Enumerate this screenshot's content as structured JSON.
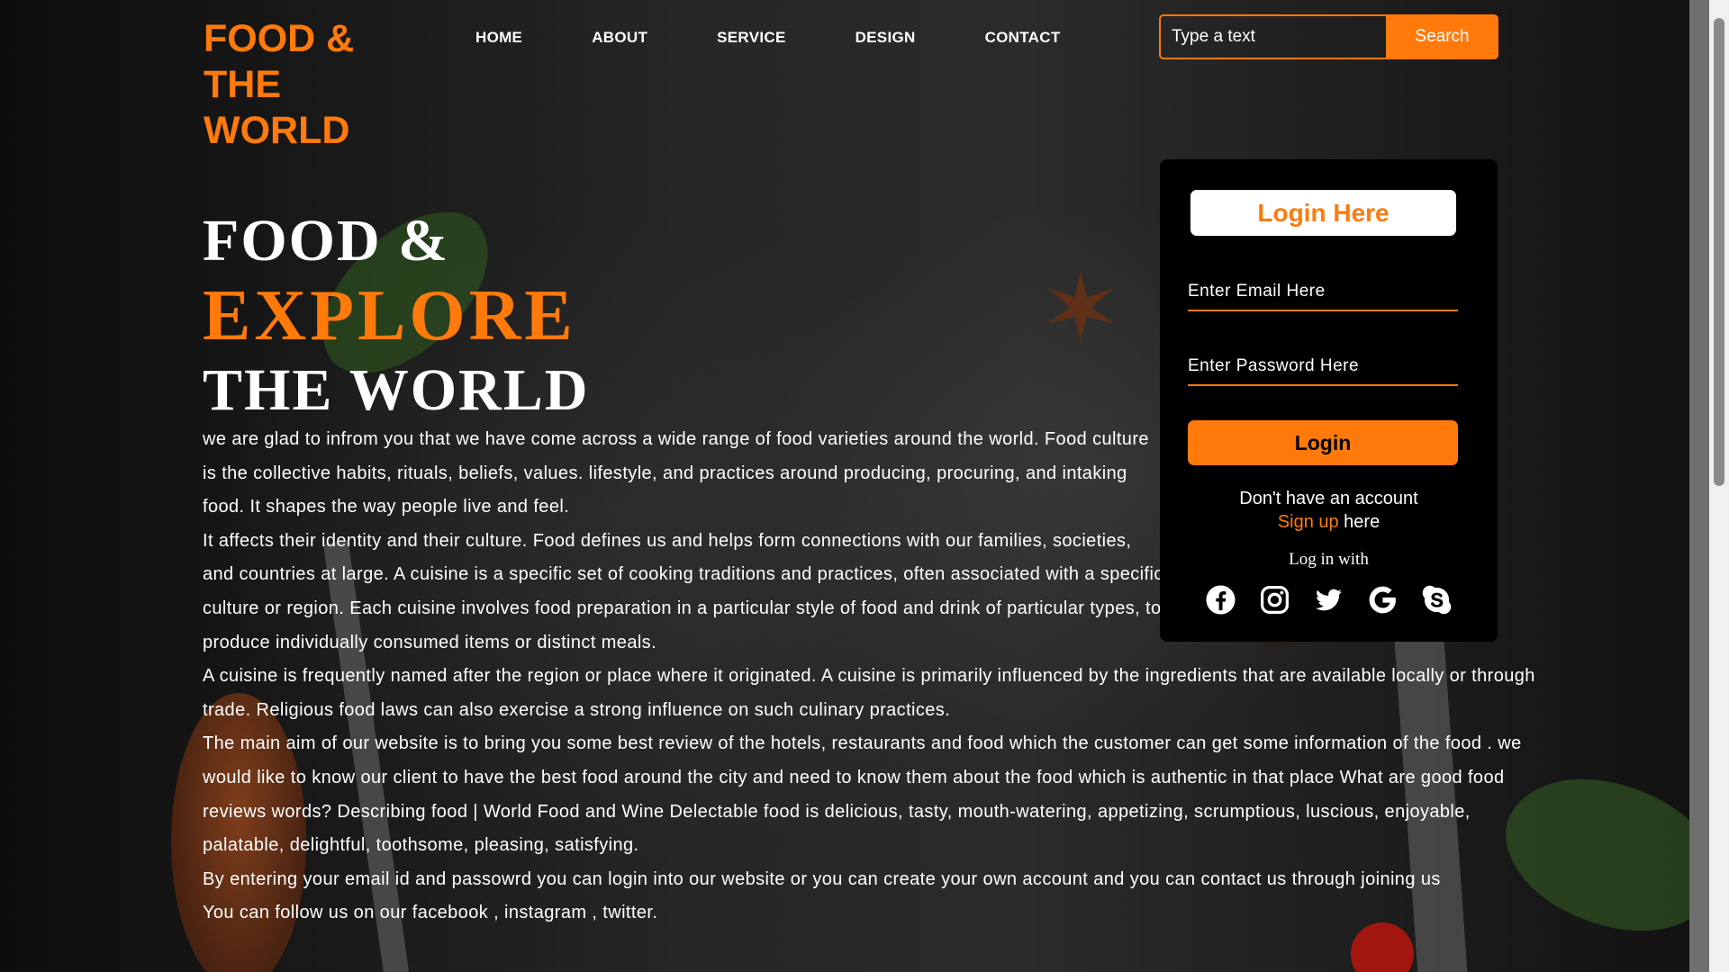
{
  "brand": {
    "logo": "FOOD & THE WORLD",
    "accent": "#ff7a0b"
  },
  "nav": {
    "items": [
      "HOME",
      "ABOUT",
      "SERVICE",
      "DESIGN",
      "CONTACT"
    ]
  },
  "search": {
    "placeholder": "Type a text",
    "button": "Search"
  },
  "hero": {
    "line1": "FOOD &",
    "line2": "EXPLORE",
    "line3": "THE WORLD"
  },
  "content": {
    "paragraphs": [
      "we are glad to infrom you that we have come across a wide range of food varieties around the world. Food culture is the collective habits, rituals, beliefs, values. lifestyle, and practices around producing, procuring, and intaking food. It shapes the way people live and feel.",
      "It affects their identity and their culture. Food defines us and helps form connections with our families, societies, and countries at large. A cuisine is a specific set of cooking traditions and practices, often associated with a specific culture or region. Each cuisine involves food preparation in a particular style of food and drink of particular types, to produce individually consumed items or distinct meals.",
      "A cuisine is frequently named after the region or place where it originated. A cuisine is primarily influenced by the ingredients that are available locally or through trade. Religious food laws can also exercise a strong influence on such culinary practices.",
      "The main aim of our website is to bring you some best review of the hotels, restaurants and food which the customer can get some information of the food . we would like to know our client to have the best food around the city and need to know them about the food which is authentic in that place What are good food reviews words? Describing food | World Food and Wine Delectable food is delicious, tasty, mouth-watering, appetizing, scrumptious, luscious, enjoyable, palatable, delightful, toothsome, pleasing, satisfying.",
      "By entering your email id and passowrd you can login into our website or you can create your own account and you can contact us through joining us",
      "You can follow us on our facebook , instagram , twitter."
    ]
  },
  "login": {
    "title": "Login Here",
    "email_placeholder": "Enter Email Here",
    "password_placeholder": "Enter Password Here",
    "button": "Login",
    "no_account": "Don't have an account",
    "signup_link": "Sign up",
    "signup_suffix": " here",
    "login_with": "Log in with",
    "socials": [
      "facebook-icon",
      "instagram-icon",
      "twitter-icon",
      "google-icon",
      "skype-icon"
    ]
  }
}
